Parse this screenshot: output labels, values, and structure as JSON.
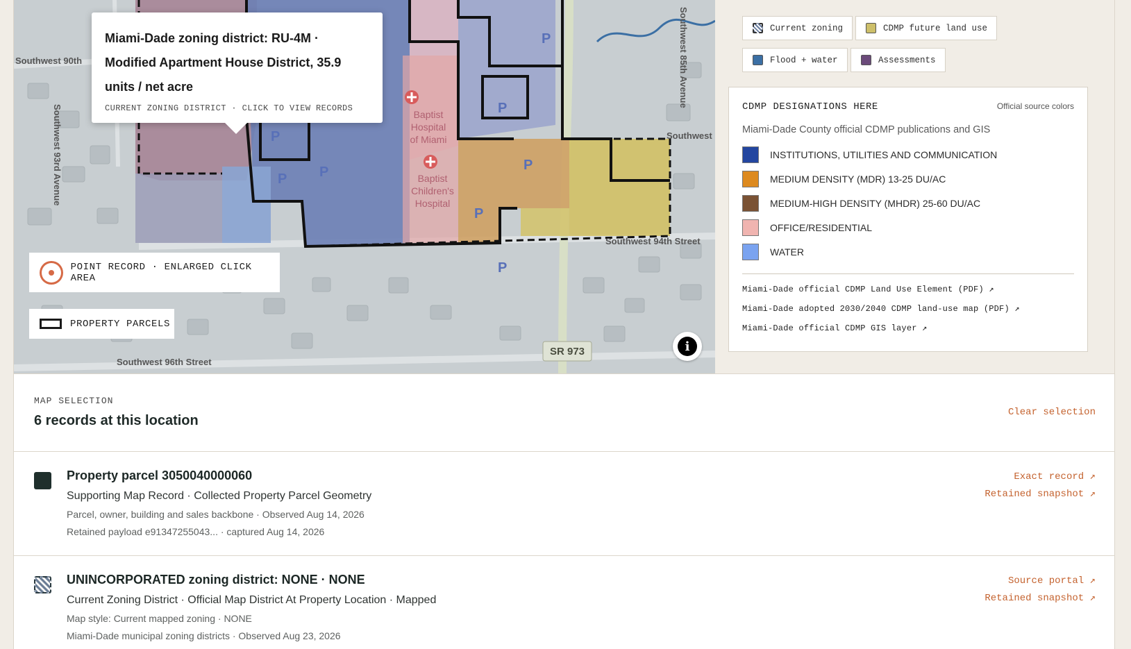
{
  "tooltip": {
    "title": "Miami-Dade zoning district: RU-4M · Modified Apartment House District, 35.9 units / net acre",
    "subtitle": "CURRENT ZONING DISTRICT · CLICK TO VIEW RECORDS"
  },
  "map_legend": {
    "point": "POINT RECORD · ENLARGED CLICK AREA",
    "parcels": "PROPERTY PARCELS"
  },
  "map_labels": {
    "street_90th": "Southwest 90th",
    "street_93rd": "Southwest 93rd Avenue",
    "street_94th": "Southwest 94th Street",
    "street_96th": "Southwest 96th Street",
    "street_85th": "Southwest 85th Avenue",
    "street_southwest": "Southwest",
    "hospital": "Baptist Hospital of Miami",
    "childrens": "Baptist Children's Hospital",
    "sr973": "SR 973",
    "parking": "P"
  },
  "layers": {
    "current_zoning": "Current zoning",
    "cdmp_future": "CDMP future land use",
    "flood": "Flood + water",
    "assessments": "Assessments",
    "colors": {
      "flood": "#3b6fa4",
      "assessments": "#6b4a7a",
      "cdmp": "#cdbf6a"
    }
  },
  "cdmp": {
    "title": "CDMP DESIGNATIONS HERE",
    "source_colors": "Official source colors",
    "description": "Miami-Dade County official CDMP publications and GIS",
    "designations": [
      {
        "label": "INSTITUTIONS, UTILITIES AND COMMUNICATION",
        "color": "#2346a0"
      },
      {
        "label": "MEDIUM DENSITY (MDR) 13-25 DU/AC",
        "color": "#dd8a1f"
      },
      {
        "label": "MEDIUM-HIGH DENSITY (MHDR) 25-60 DU/AC",
        "color": "#7a5234"
      },
      {
        "label": "OFFICE/RESIDENTIAL",
        "color": "#f0b4b0"
      },
      {
        "label": "WATER",
        "color": "#7aa3f0"
      }
    ],
    "links": [
      "Miami-Dade official CDMP Land Use Element (PDF) ↗",
      "Miami-Dade adopted 2030/2040 CDMP land-use map (PDF) ↗",
      "Miami-Dade official CDMP GIS layer ↗"
    ]
  },
  "selection": {
    "label": "MAP SELECTION",
    "count": "6 records at this location",
    "clear": "Clear selection"
  },
  "records": [
    {
      "title": "Property parcel 3050040000060",
      "line2": "Supporting Map Record · Collected Property Parcel Geometry",
      "line3": "Parcel, owner, building and sales backbone · Observed Aug 14, 2026",
      "line4": "Retained payload e91347255043... · captured Aug 14, 2026",
      "link1": "Exact record ↗",
      "link2": "Retained snapshot ↗"
    },
    {
      "title": "UNINCORPORATED zoning district: NONE · NONE",
      "line2": "Current Zoning District · Official Map District At Property Location · Mapped",
      "line3": "Map style: Current mapped zoning · NONE",
      "line4": "Miami-Dade municipal zoning districts · Observed Aug 23, 2026",
      "link1": "Source portal ↗",
      "link2": "Retained snapshot ↗"
    }
  ]
}
